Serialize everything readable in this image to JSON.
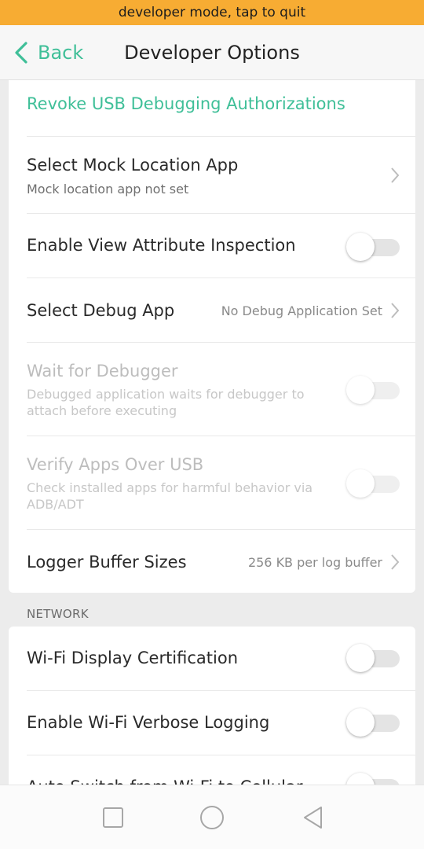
{
  "banner": {
    "text": "developer mode, tap to quit",
    "color": "#f7ac33"
  },
  "header": {
    "back_label": "Back",
    "title": "Developer Options",
    "accent": "#3fbf98"
  },
  "card1": {
    "revoke": {
      "label": "Revoke USB Debugging Authorizations"
    },
    "mock_location": {
      "title": "Select Mock Location App",
      "subtitle": "Mock location app not set"
    },
    "view_attr": {
      "title": "Enable View Attribute Inspection",
      "enabled": false
    },
    "debug_app": {
      "title": "Select Debug App",
      "value": "No Debug Application Set"
    },
    "wait_debugger": {
      "title": "Wait for Debugger",
      "subtitle": "Debugged application waits for debugger to attach before executing",
      "enabled": false
    },
    "verify_usb": {
      "title": "Verify Apps Over USB",
      "subtitle": "Check installed apps for harmful behavior via ADB/ADT",
      "enabled": false
    },
    "logger": {
      "title": "Logger Buffer Sizes",
      "value": "256 KB per log buffer"
    }
  },
  "network": {
    "section_label": "NETWORK",
    "wifi_display": {
      "title": "Wi-Fi Display Certification",
      "enabled": false
    },
    "wifi_verbose": {
      "title": "Enable Wi-Fi Verbose Logging",
      "enabled": false
    },
    "auto_switch": {
      "title": "Auto Switch from Wi-Fi to Cellular",
      "enabled": false
    }
  },
  "nav": {
    "recents": "square-icon",
    "home": "circle-icon",
    "back": "triangle-back-icon"
  }
}
